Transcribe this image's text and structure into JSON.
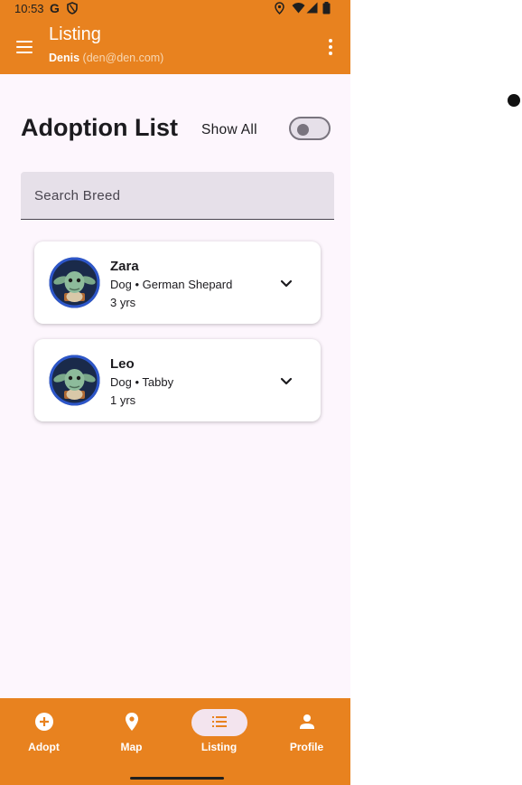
{
  "status_bar": {
    "time": "10:53",
    "g": "G"
  },
  "app_bar": {
    "title": "Listing",
    "user_name": "Denis",
    "user_email": "(den@den.com)",
    "menu_icon": "hamburger-menu-icon",
    "overflow_icon": "more-vert-icon"
  },
  "main": {
    "heading": "Adoption List",
    "show_all_label": "Show All",
    "show_all_on": false,
    "search_placeholder": "Search Breed",
    "pets": [
      {
        "name": "Zara",
        "meta": "Dog • German Shepard",
        "age": "3 yrs"
      },
      {
        "name": "Leo",
        "meta": "Dog • Tabby",
        "age": "1 yrs"
      }
    ]
  },
  "nav": {
    "items": [
      {
        "label": "Adopt",
        "icon": "add-circle-icon"
      },
      {
        "label": "Map",
        "icon": "location-pin-icon"
      },
      {
        "label": "Listing",
        "icon": "list-icon",
        "selected": true
      },
      {
        "label": "Profile",
        "icon": "person-icon"
      }
    ]
  },
  "colors": {
    "primary": "#e8821f",
    "surface": "#fdf6fd",
    "selected_pill": "#f3e4ee"
  }
}
